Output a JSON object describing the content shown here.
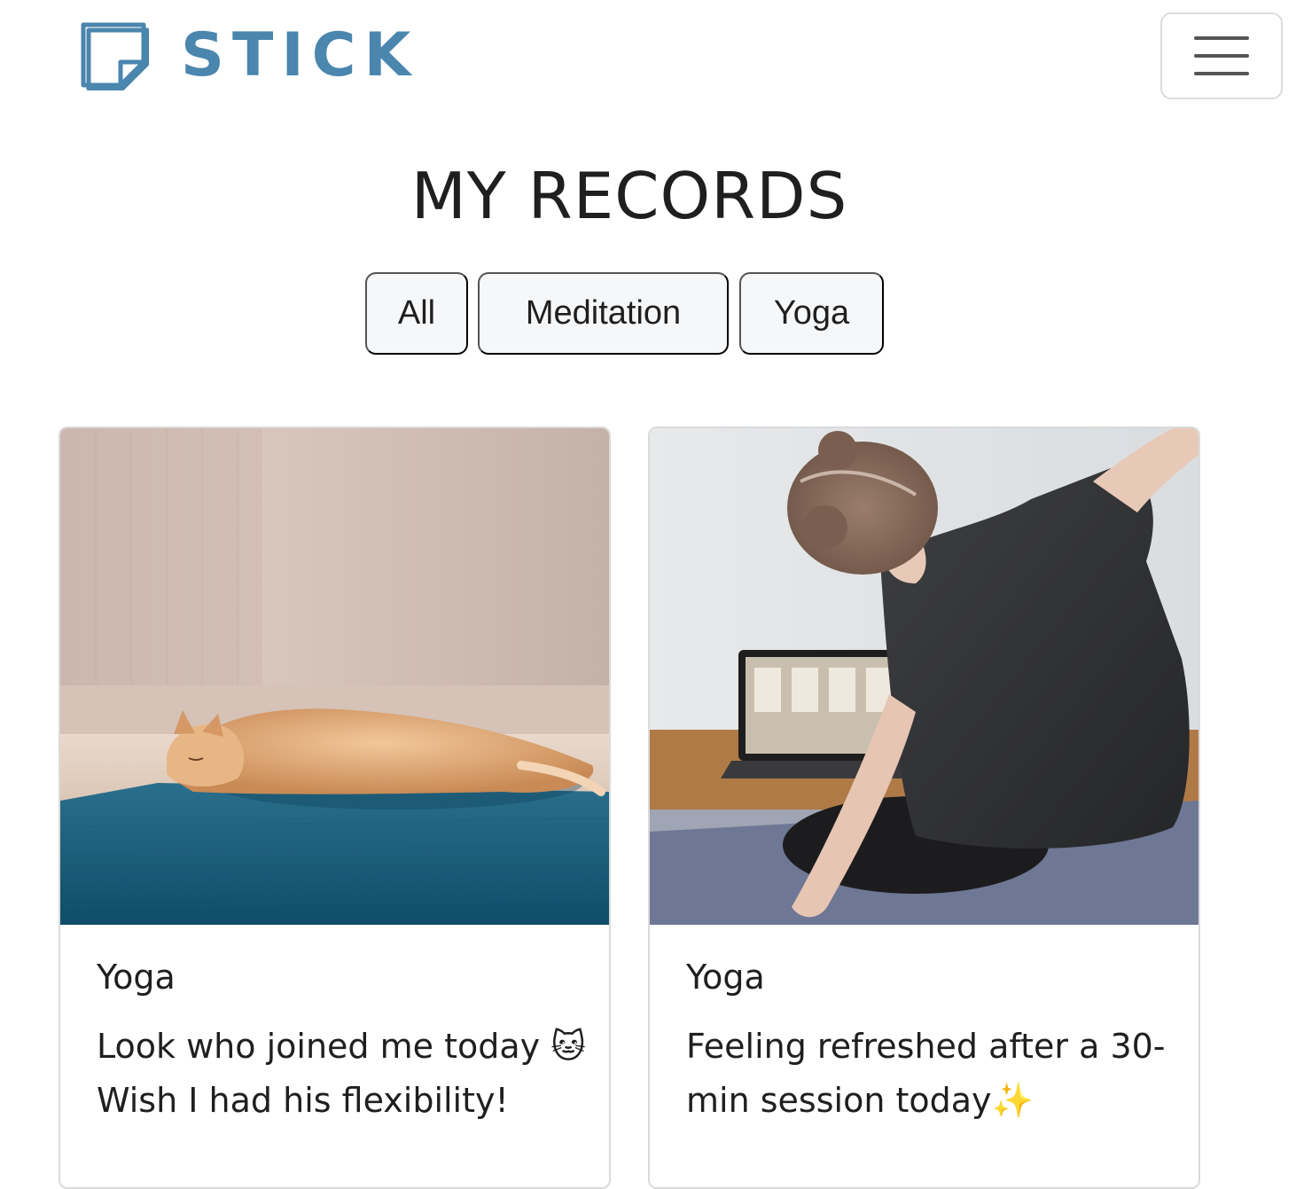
{
  "navbar": {
    "brand_name": "STICK",
    "brand_icon": "sticky-note-icon",
    "brand_color": "#4a86ae",
    "menu_icon": "hamburger-menu-icon"
  },
  "page": {
    "title": "MY RECORDS"
  },
  "filters": [
    {
      "label": "All"
    },
    {
      "label": "Meditation"
    },
    {
      "label": "Yoga"
    }
  ],
  "cards": [
    {
      "image": "photo-cat-sleeping-on-yoga-mat",
      "category": "Yoga",
      "text": "Look who joined me today 🐱 Wish I had his flexibility!"
    },
    {
      "image": "photo-woman-stretching-in-front-of-laptop",
      "category": "Yoga",
      "text": "Feeling refreshed after a 30-min session today✨"
    }
  ]
}
